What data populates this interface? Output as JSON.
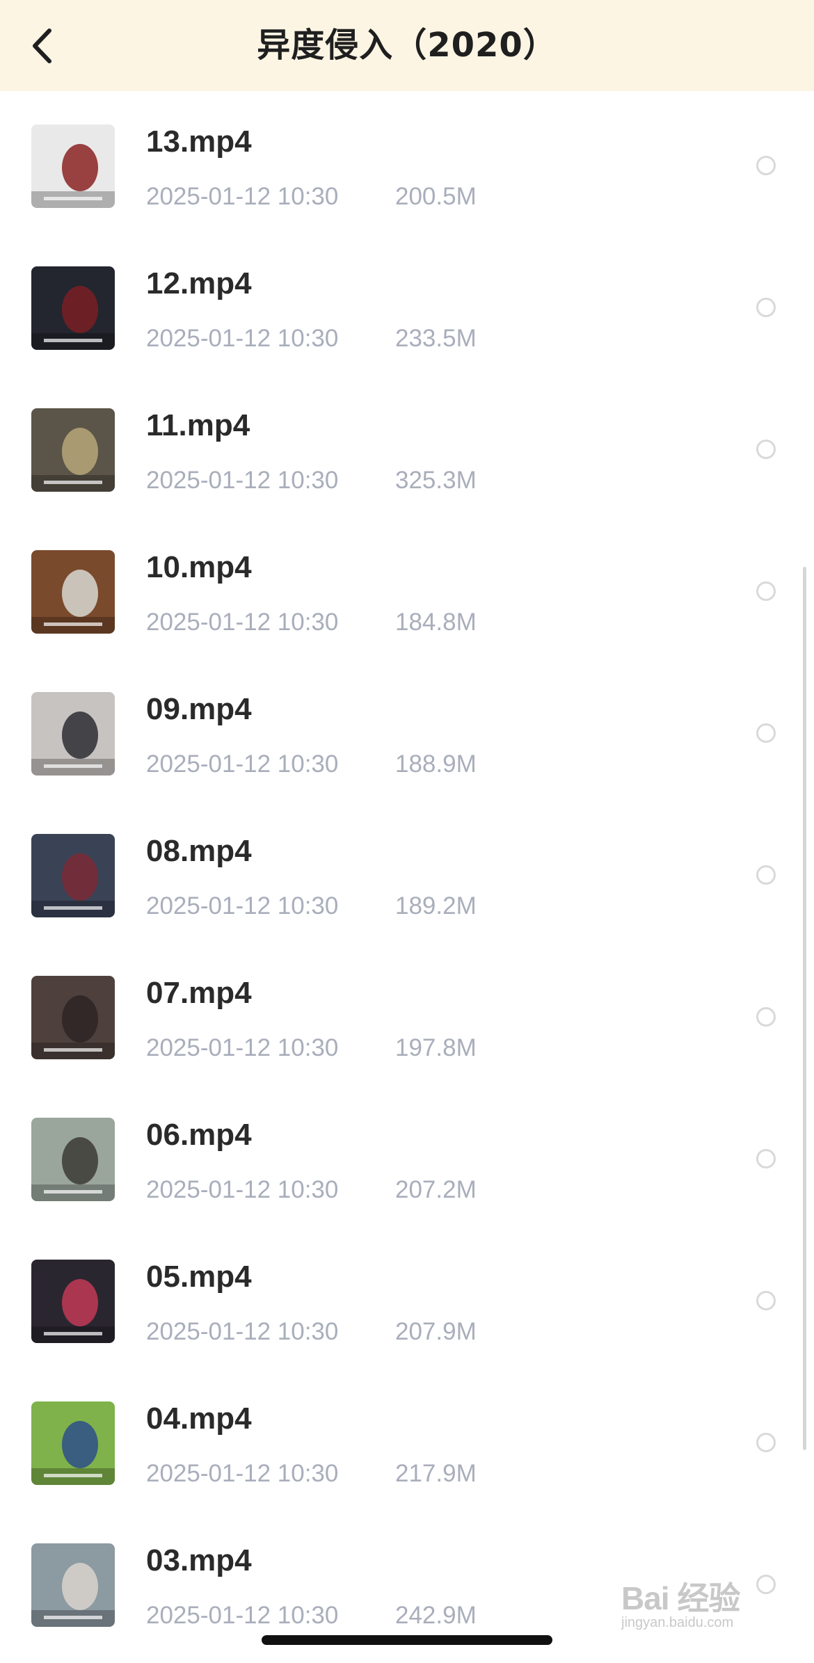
{
  "header": {
    "title": "异度侵入（2020）"
  },
  "files": [
    {
      "name": "13.mp4",
      "date": "2025-01-12 10:30",
      "size": "200.5M",
      "thumb_bg": "#e9e9e9",
      "thumb_accent": "#8b2222"
    },
    {
      "name": "12.mp4",
      "date": "2025-01-12 10:30",
      "size": "233.5M",
      "thumb_bg": "#23262e",
      "thumb_accent": "#7a1f24"
    },
    {
      "name": "11.mp4",
      "date": "2025-01-12 10:30",
      "size": "325.3M",
      "thumb_bg": "#5a5548",
      "thumb_accent": "#b8a77a"
    },
    {
      "name": "10.mp4",
      "date": "2025-01-12 10:30",
      "size": "184.8M",
      "thumb_bg": "#7a4a2c",
      "thumb_accent": "#d8d8d2"
    },
    {
      "name": "09.mp4",
      "date": "2025-01-12 10:30",
      "size": "188.9M",
      "thumb_bg": "#c7c3c0",
      "thumb_accent": "#2d2d33"
    },
    {
      "name": "08.mp4",
      "date": "2025-01-12 10:30",
      "size": "189.2M",
      "thumb_bg": "#3a4256",
      "thumb_accent": "#7b2a35"
    },
    {
      "name": "07.mp4",
      "date": "2025-01-12 10:30",
      "size": "197.8M",
      "thumb_bg": "#4e403c",
      "thumb_accent": "#2e2523"
    },
    {
      "name": "06.mp4",
      "date": "2025-01-12 10:30",
      "size": "207.2M",
      "thumb_bg": "#9aa69c",
      "thumb_accent": "#3c3a36"
    },
    {
      "name": "05.mp4",
      "date": "2025-01-12 10:30",
      "size": "207.9M",
      "thumb_bg": "#2a2630",
      "thumb_accent": "#c23a56"
    },
    {
      "name": "04.mp4",
      "date": "2025-01-12 10:30",
      "size": "217.9M",
      "thumb_bg": "#7fb24a",
      "thumb_accent": "#2d4f8a"
    },
    {
      "name": "03.mp4",
      "date": "2025-01-12 10:30",
      "size": "242.9M",
      "thumb_bg": "#8c9aa2",
      "thumb_accent": "#d9d4cc"
    }
  ],
  "watermark": {
    "logo": "Bai 经验",
    "sub": "jingyan.baidu.com"
  },
  "icons": {
    "back": "chevron-left-icon",
    "select": "radio-circle-icon"
  }
}
